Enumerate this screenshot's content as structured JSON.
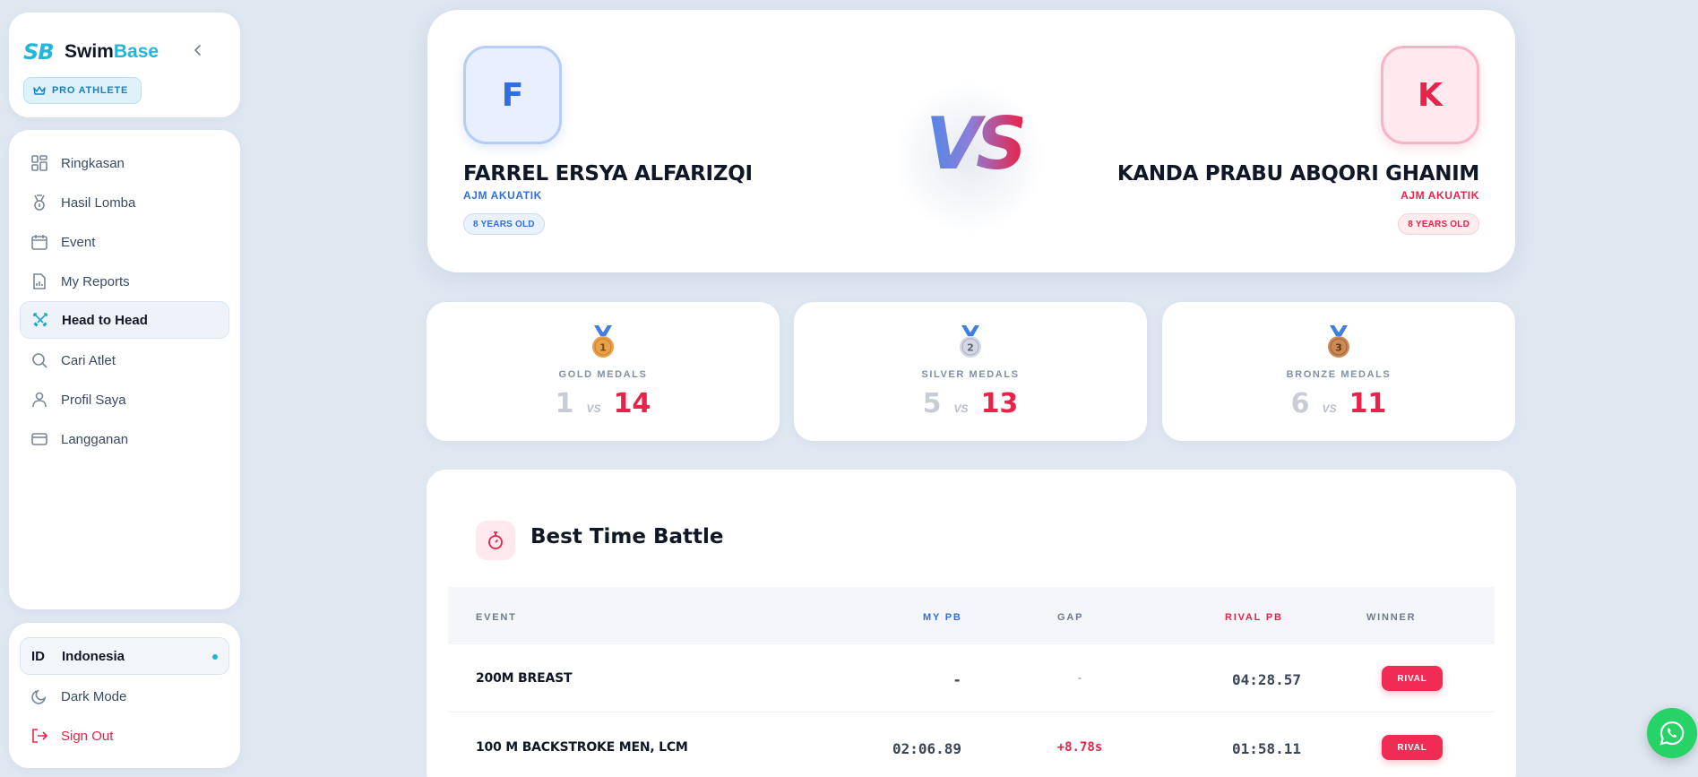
{
  "brand": {
    "logo_mark": "SB",
    "name_part1": "Swim",
    "name_part2": "Base",
    "badge": "PRO ATHLETE"
  },
  "sidebar": {
    "items": [
      {
        "label": "Ringkasan",
        "icon": "grid-icon"
      },
      {
        "label": "Hasil Lomba",
        "icon": "medal-icon"
      },
      {
        "label": "Event",
        "icon": "calendar-icon"
      },
      {
        "label": "My Reports",
        "icon": "report-icon"
      },
      {
        "label": "Head to Head",
        "icon": "swords-icon",
        "active": true
      },
      {
        "label": "Cari Atlet",
        "icon": "search-icon"
      },
      {
        "label": "Profil Saya",
        "icon": "user-icon"
      },
      {
        "label": "Langganan",
        "icon": "card-icon"
      }
    ],
    "language": {
      "code": "ID",
      "label": "Indonesia"
    },
    "dark_mode": "Dark Mode",
    "sign_out": "Sign Out"
  },
  "hero": {
    "left": {
      "initial": "F",
      "name": "FARREL ERSYA ALFARIZQI",
      "club": "AJM AKUATIK",
      "age": "8 YEARS OLD"
    },
    "right": {
      "initial": "K",
      "name": "KANDA PRABU ABQORI GHANIM",
      "club": "AJM AKUATIK",
      "age": "8 YEARS OLD"
    },
    "vs": "VS"
  },
  "medals": [
    {
      "rank": "1",
      "label": "GOLD MEDALS",
      "mine": "1",
      "vs": "VS",
      "rival": "14",
      "color": "#e9a04a"
    },
    {
      "rank": "2",
      "label": "SILVER MEDALS",
      "mine": "5",
      "vs": "VS",
      "rival": "13",
      "color": "#c9cfdc"
    },
    {
      "rank": "3",
      "label": "BRONZE MEDALS",
      "mine": "6",
      "vs": "VS",
      "rival": "11",
      "color": "#c98a55"
    }
  ],
  "battle": {
    "title": "Best Time Battle",
    "headers": {
      "event": "EVENT",
      "mypb": "MY PB",
      "gap": "GAP",
      "rivalpb": "RIVAL PB",
      "winner": "WINNER"
    },
    "rows": [
      {
        "event": "200M BREAST",
        "mypb": "-",
        "gap": "-",
        "rivalpb": "04:28.57",
        "winner": "RIVAL"
      },
      {
        "event": "100 M BACKSTROKE MEN, LCM",
        "mypb": "02:06.89",
        "gap": "+8.78s",
        "rivalpb": "01:58.11",
        "winner": "RIVAL"
      }
    ]
  },
  "colors": {
    "accent": "#22b6da",
    "blue": "#2f6fe0",
    "red": "#e8234a",
    "background": "#dfe7f1"
  }
}
